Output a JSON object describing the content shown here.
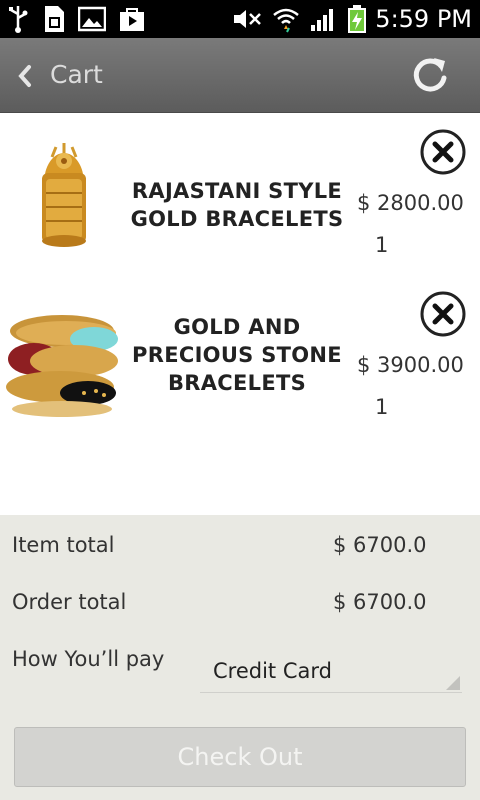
{
  "status_bar": {
    "time": "5:59 PM",
    "left_icons": [
      "usb-icon",
      "sim-card-icon",
      "gallery-icon",
      "play-store-icon"
    ],
    "right_icons": [
      "no-sound-icon",
      "wifi-icon",
      "signal-icon",
      "battery-charging-icon"
    ]
  },
  "action_bar": {
    "title": "Cart",
    "back_icon": "chevron-left-icon",
    "refresh_icon": "refresh-icon"
  },
  "cart": {
    "items": [
      {
        "name": "RAJASTANI STYLE GOLD BRACELETS",
        "price": "$ 2800.00",
        "quantity": "1",
        "image": "gold-bracelet-image"
      },
      {
        "name": "GOLD AND PRECIOUS STONE BRACELETS",
        "price": "$ 3900.00",
        "quantity": "1",
        "image": "stone-bracelets-image"
      }
    ]
  },
  "summary": {
    "item_total_label": "Item total",
    "item_total_value": "$ 6700.0",
    "order_total_label": "Order total",
    "order_total_value": "$ 6700.0",
    "pay_label": "How You’ll pay",
    "pay_value": "Credit Card",
    "checkout_label": "Check Out"
  },
  "colors": {
    "action_bar": "#6a6a6a",
    "summary_background": "#e9e9e3",
    "checkout_button": "#d3d3d0"
  }
}
